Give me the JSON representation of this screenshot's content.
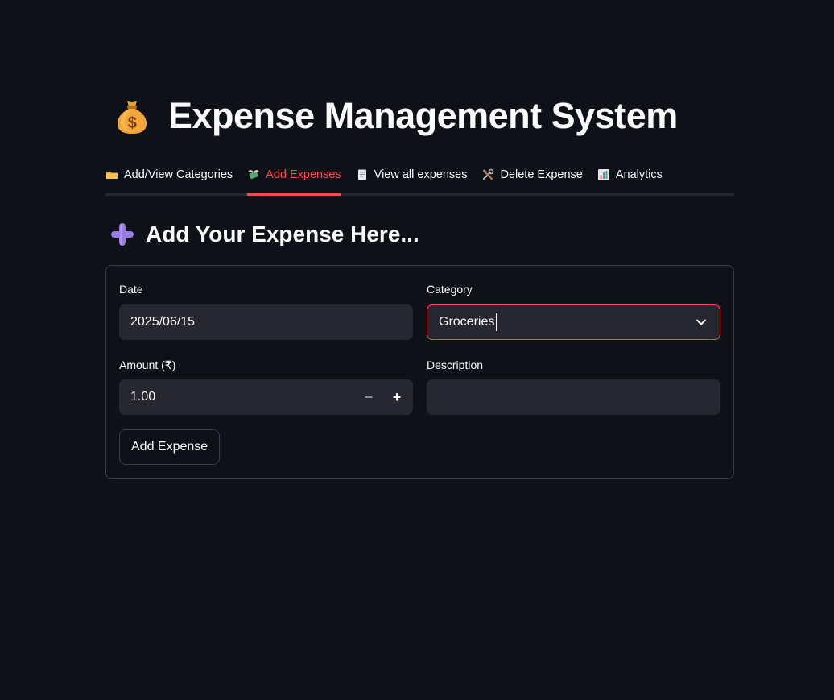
{
  "header": {
    "title": "Expense Management System",
    "title_icon": "money-bag-icon"
  },
  "tabs": [
    {
      "label": "Add/View Categories",
      "icon": "folder-icon",
      "active": false
    },
    {
      "label": "Add Expenses",
      "icon": "money-wings-icon",
      "active": true
    },
    {
      "label": "View all expenses",
      "icon": "document-icon",
      "active": false
    },
    {
      "label": "Delete Expense",
      "icon": "tools-icon",
      "active": false
    },
    {
      "label": "Analytics",
      "icon": "bar-chart-icon",
      "active": false
    }
  ],
  "form": {
    "heading": "Add Your Expense Here...",
    "heading_icon": "plus-icon",
    "date": {
      "label": "Date",
      "value": "2025/06/15"
    },
    "category": {
      "label": "Category",
      "value": "Groceries"
    },
    "amount": {
      "label": "Amount (₹)",
      "value": "1.00",
      "minus": "−",
      "plus": "+"
    },
    "description": {
      "label": "Description",
      "value": ""
    },
    "submit_label": "Add Expense"
  },
  "colors": {
    "background": "#0e1117",
    "accent": "#ff4b4b",
    "input_bg": "#262730",
    "text": "#fafafa"
  }
}
